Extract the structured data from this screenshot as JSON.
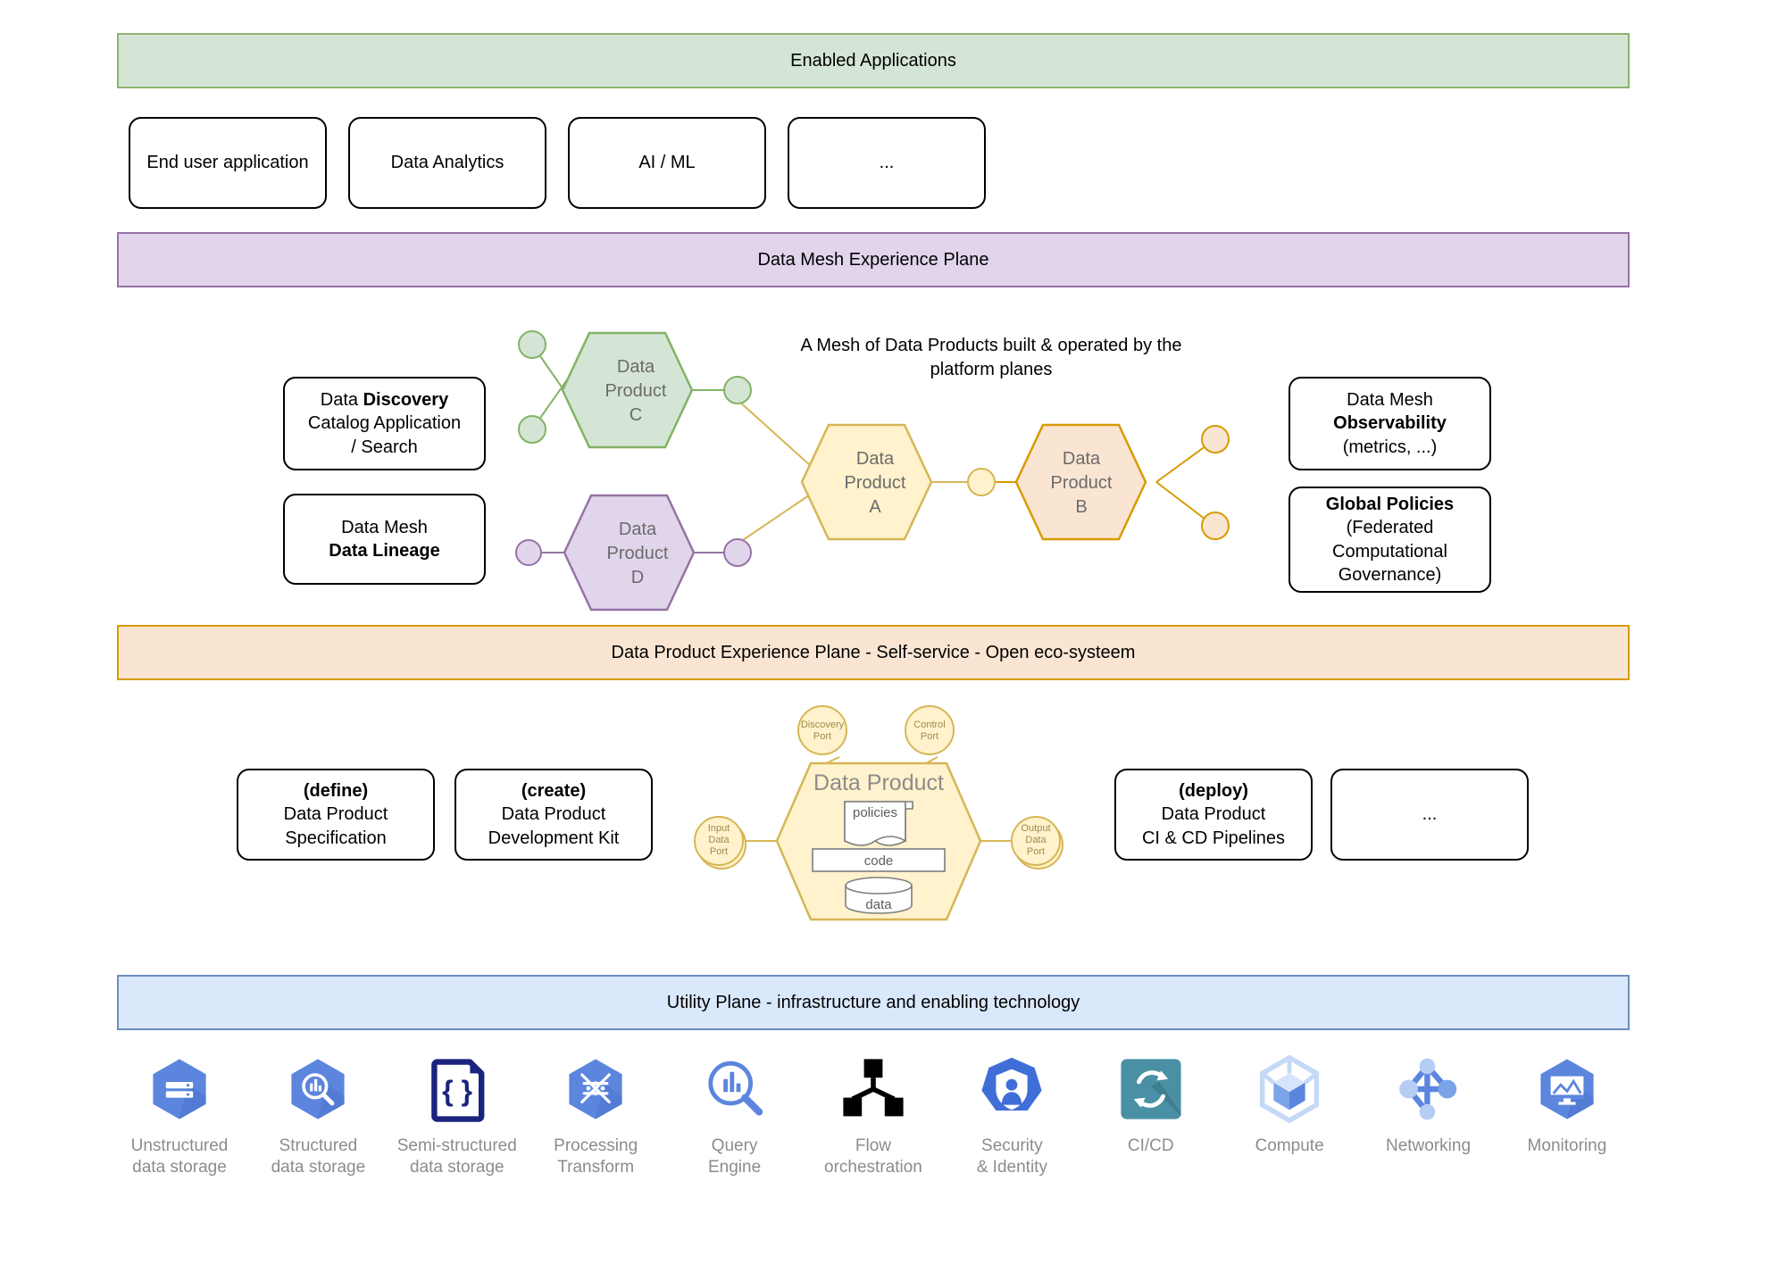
{
  "planes": {
    "enabled_applications": "Enabled Applications",
    "data_mesh_experience": "Data Mesh Experience Plane",
    "data_product_experience": "Data Product Experience Plane - Self-service - Open eco-systeem",
    "utility": "Utility Plane - infrastructure and enabling technology"
  },
  "applications": [
    {
      "label": "End user application"
    },
    {
      "label": "Data Analytics"
    },
    {
      "label": "AI / ML"
    },
    {
      "label": "..."
    }
  ],
  "mesh": {
    "note_line1": "A Mesh of Data Products built & operated by the",
    "note_line2": "platform planes",
    "left_boxes": [
      {
        "l1": "Data ",
        "l1b": "Discovery",
        "l2": "Catalog Application",
        "l3": "/ Search"
      },
      {
        "l1": "Data Mesh",
        "l1b": "",
        "l2": "Data Lineage",
        "l3": ""
      }
    ],
    "right_boxes": [
      {
        "l1": "Data Mesh",
        "l2": "Observability",
        "l3": "(metrics, ...)"
      },
      {
        "l1": "Global Policies",
        "l2": "(Federated",
        "l3": "Computational",
        "l4": "Governance)"
      }
    ],
    "products": [
      {
        "id": "C",
        "line1": "Data",
        "line2": "Product",
        "line3": "C",
        "fill": "#d5e5d5",
        "stroke": "#82b366"
      },
      {
        "id": "D",
        "line1": "Data",
        "line2": "Product",
        "line3": "D",
        "fill": "#e1d5ec",
        "stroke": "#9673a6"
      },
      {
        "id": "A",
        "line1": "Data",
        "line2": "Product",
        "line3": "A",
        "fill": "#fff2cc",
        "stroke": "#d6b656"
      },
      {
        "id": "B",
        "line1": "Data",
        "line2": "Product",
        "line3": "B",
        "fill": "#fae5d3",
        "stroke": "#d79b00"
      }
    ]
  },
  "data_product_detail": {
    "title": "Data Product",
    "discovery_port": "Discovery\nPort",
    "discovery_port_l1": "Discovery",
    "discovery_port_l2": "Port",
    "control_port_l1": "Control",
    "control_port_l2": "Port",
    "input_port_l1": "Input",
    "input_port_l2": "Data",
    "input_port_l3": "Port",
    "output_port_l1": "Output",
    "output_port_l2": "Data",
    "output_port_l3": "Port",
    "policies": "policies",
    "code": "code",
    "data": "data",
    "fill": "#fff2cc",
    "stroke": "#d6b656"
  },
  "lifecycle_boxes": [
    {
      "bold": "(define)",
      "l2": "Data Product",
      "l3": "Specification"
    },
    {
      "bold": "(create)",
      "l2": "Data Product",
      "l3": "Development Kit"
    },
    {
      "bold": "(deploy)",
      "l2": "Data Product",
      "l3": "CI & CD Pipelines"
    },
    {
      "bold": "",
      "l2": "...",
      "l3": ""
    }
  ],
  "utility_items": [
    {
      "icon": "unstructured-data-storage-icon",
      "label": "Unstructured\ndata storage"
    },
    {
      "icon": "structured-data-storage-icon",
      "label": "Structured\ndata storage"
    },
    {
      "icon": "semi-structured-data-storage-icon",
      "label": "Semi-structured\ndata storage"
    },
    {
      "icon": "processing-transform-icon",
      "label": "Processing\nTransform"
    },
    {
      "icon": "query-engine-icon",
      "label": "Query\nEngine"
    },
    {
      "icon": "flow-orchestration-icon",
      "label": "Flow\norchestration"
    },
    {
      "icon": "security-identity-icon",
      "label": "Security\n& Identity"
    },
    {
      "icon": "cicd-icon",
      "label": "CI/CD"
    },
    {
      "icon": "compute-icon",
      "label": "Compute"
    },
    {
      "icon": "networking-icon",
      "label": "Networking"
    },
    {
      "icon": "monitoring-icon",
      "label": "Monitoring"
    }
  ],
  "colors": {
    "green_band_fill": "#d5e5d5",
    "green_band_border": "#8cb46e",
    "purple_band_fill": "#e1d5ec",
    "purple_band_border": "#9673a6",
    "orange_band_fill": "#fae5d3",
    "orange_band_border": "#d79b00",
    "blue_band_fill": "#dae8fc",
    "blue_band_border": "#6c8ebf",
    "gcp_blue": "#5c85de",
    "gcp_navy": "#1a237e",
    "cicd_teal": "#4a90a4",
    "caption_gray": "#8c8c8c"
  }
}
